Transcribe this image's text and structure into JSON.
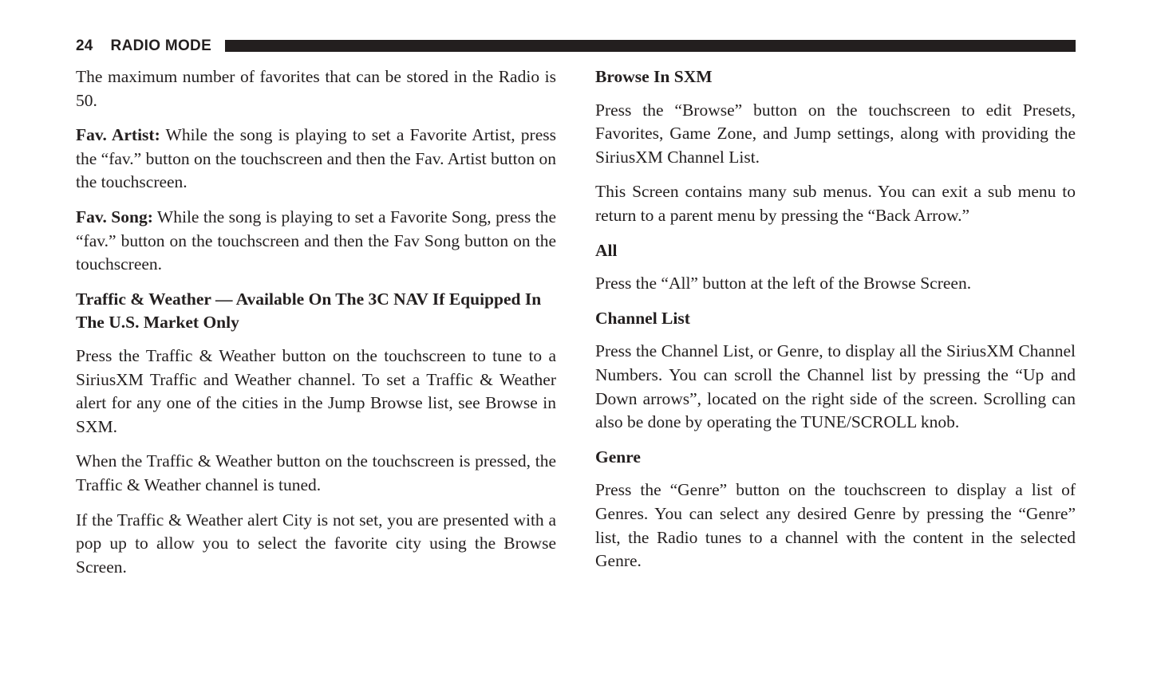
{
  "header": {
    "page_number": "24",
    "section_title": "RADIO MODE",
    "rule_color": "#231f1f"
  },
  "left_column": {
    "blocks": [
      {
        "kind": "paragraph",
        "text": "The maximum number of favorites that can be stored in the Radio is 50."
      },
      {
        "kind": "paragraph_leadin",
        "lead_in": "Fav. Artist:",
        "text": " While the song is playing to set a Favorite Artist, press the “fav.” button on the touchscreen and then the Fav. Artist button on the touchscreen."
      },
      {
        "kind": "paragraph_leadin",
        "lead_in": "Fav. Song:",
        "text": " While the song is playing to set a Favorite Song, press the “fav.” button on the touchscreen and then the Fav Song button on the touchscreen."
      },
      {
        "kind": "heading",
        "text": "Traffic & Weather — Available On The 3C NAV If Equipped In The U.S. Market Only"
      },
      {
        "kind": "paragraph",
        "text": "Press the Traffic & Weather button on the touchscreen to tune to a SiriusXM Traffic and Weather channel. To set a Traffic & Weather alert for any one of the cities in the Jump Browse list, see Browse in SXM."
      },
      {
        "kind": "paragraph",
        "text": "When the Traffic & Weather button on the touchscreen is pressed, the Traffic & Weather channel is tuned."
      },
      {
        "kind": "paragraph",
        "text": "If the Traffic & Weather alert City is not set, you are presented with a pop up to allow you to select the favorite city using the Browse Screen."
      }
    ]
  },
  "right_column": {
    "blocks": [
      {
        "kind": "heading",
        "text": "Browse In SXM"
      },
      {
        "kind": "paragraph",
        "text": "Press the “Browse” button on the touchscreen to edit Presets, Favorites, Game Zone, and Jump settings, along with providing the SiriusXM Channel List."
      },
      {
        "kind": "paragraph",
        "text": "This Screen contains many sub menus. You can exit a sub menu to return to a parent menu by pressing the “Back Arrow.”"
      },
      {
        "kind": "heading",
        "text": "All"
      },
      {
        "kind": "paragraph",
        "text": "Press the “All” button at the left of the Browse Screen."
      },
      {
        "kind": "heading",
        "text": "Channel List"
      },
      {
        "kind": "paragraph",
        "text": "Press the Channel List, or Genre, to display all the SiriusXM Channel Numbers. You can scroll the Channel list by pressing the “Up and Down arrows”, located on the right side of the screen. Scrolling can also be done by operating the TUNE/SCROLL knob."
      },
      {
        "kind": "heading",
        "text": "Genre"
      },
      {
        "kind": "paragraph",
        "text": "Press the “Genre” button on the touchscreen to display a list of Genres. You can select any desired Genre by pressing the “Genre” list, the Radio tunes to a channel with the content in the selected Genre."
      }
    ]
  }
}
